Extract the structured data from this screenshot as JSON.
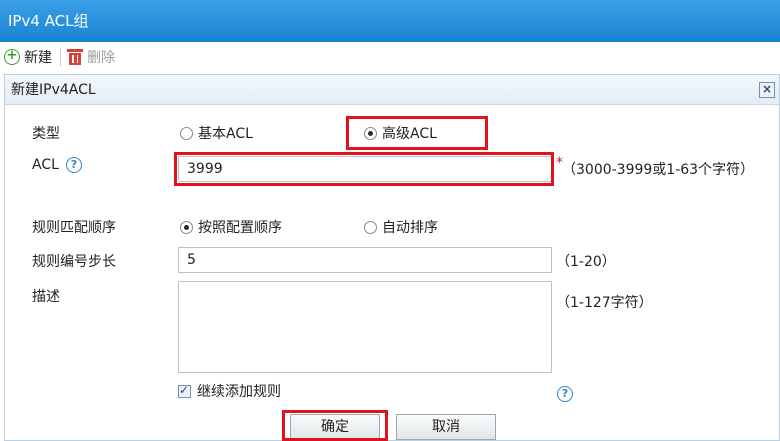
{
  "window": {
    "title": "IPv4 ACL组"
  },
  "toolbar": {
    "new_label": "新建",
    "delete_label": "删除"
  },
  "dialog": {
    "title": "新建IPv4ACL",
    "close_symbol": "×",
    "type": {
      "label": "类型",
      "options": [
        "基本ACL",
        "高级ACL"
      ],
      "selected": "高级ACL"
    },
    "acl": {
      "label": "ACL",
      "value": "3999",
      "required_mark": "*",
      "hint": "（3000-3999或1-63个字符）"
    },
    "match_order": {
      "label": "规则匹配顺序",
      "options": [
        "按照配置顺序",
        "自动排序"
      ],
      "selected": "按照配置顺序"
    },
    "step": {
      "label": "规则编号步长",
      "value": "5",
      "hint": "（1-20）"
    },
    "description": {
      "label": "描述",
      "value": "",
      "hint": "（1-127字符）"
    },
    "continue_add": {
      "label": "继续添加规则",
      "checked": true
    },
    "buttons": {
      "ok": "确定",
      "cancel": "取消"
    },
    "help_symbol": "?"
  },
  "colors": {
    "titlebar": "#1f8ad6",
    "highlight": "#e0131d",
    "panel_border": "#b9cfe2"
  },
  "icons": {
    "new": "plus-circle-icon",
    "delete": "trash-icon",
    "close": "close-icon",
    "help": "help-icon"
  }
}
